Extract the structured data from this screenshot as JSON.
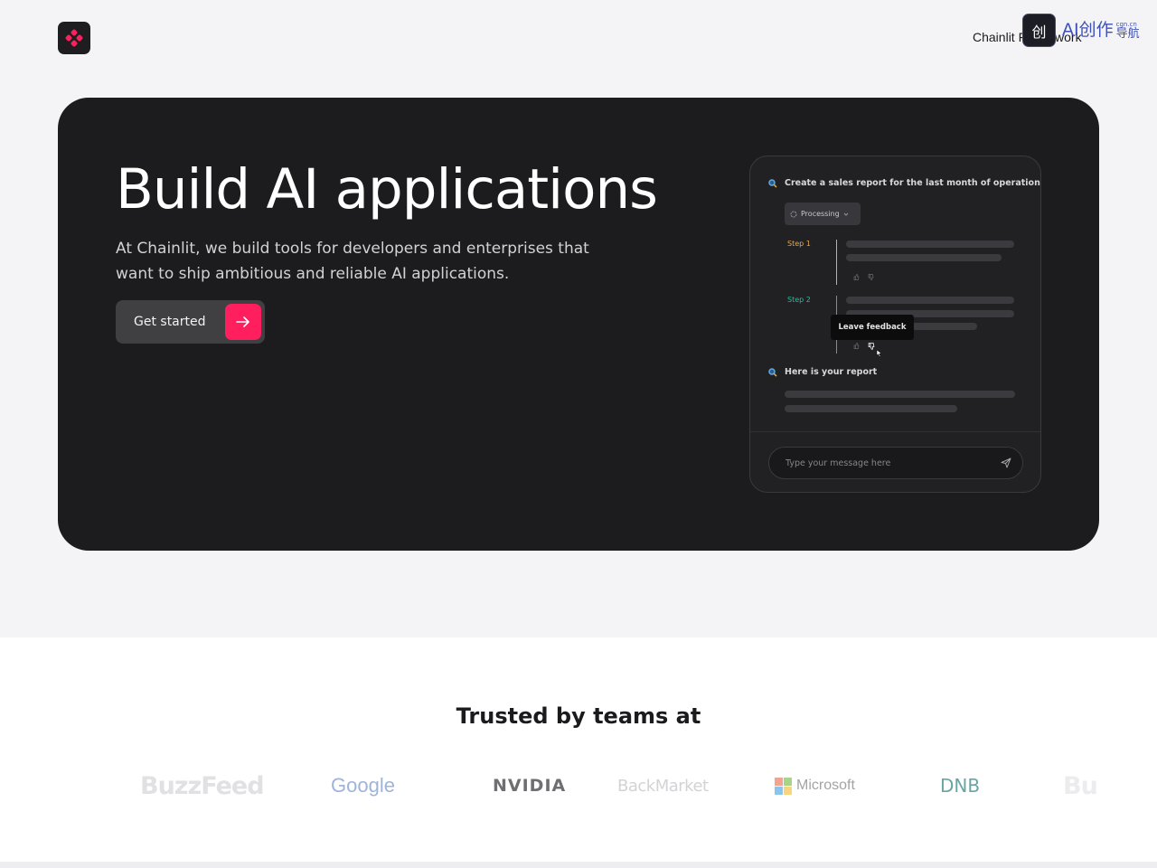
{
  "header": {
    "nav_link": "Chainlit Framework",
    "watermark": {
      "main": "AI创作",
      "small": "cgn.cn",
      "nav": "导航",
      "badge": "创"
    }
  },
  "hero": {
    "title": "Build AI applications",
    "description": "At Chainlit, we build tools for developers and enterprises that want to ship ambitious and reliable AI applications.",
    "cta_label": "Get started"
  },
  "chat_preview": {
    "user_message": "Create a sales report for the last month of operations.",
    "processing_label": "Processing",
    "steps": [
      {
        "label": "Step 1",
        "color": "#e8a84f"
      },
      {
        "label": "Step 2",
        "color": "#2bb8a0"
      }
    ],
    "tooltip": "Leave feedback",
    "report_label": "Here is your report",
    "input_placeholder": "Type your message here"
  },
  "trusted": {
    "title": "Trusted by teams at",
    "logos": [
      "BuzzFeed",
      "Google",
      "NVIDIA",
      "BackMarket",
      "Microsoft",
      "DNB",
      "Bu"
    ]
  },
  "colors": {
    "accent": "#ff1f5e",
    "hero_bg": "#1c1c1e",
    "page_bg": "#f4f4f6"
  }
}
